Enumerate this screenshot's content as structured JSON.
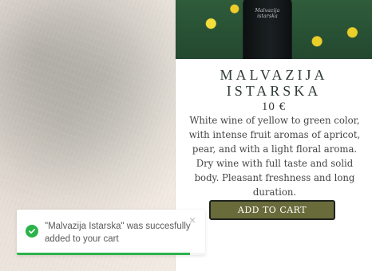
{
  "product": {
    "title": "MALVAZIJA ISTARSKA",
    "price": "10 €",
    "description": "White wine of yellow to green color, with intense fruit aromas of apricot, pear, and with a light floral aroma. Dry wine with full taste and solid body. Pleasant freshness and long duration.",
    "bottle_label": "Malvazija istarska",
    "add_to_cart_label": "ADD TO CART"
  },
  "toast": {
    "message": "\"Malvazija Istarska\" was succesfully added to your cart",
    "close_label": "×",
    "progress_fraction": 0.92
  },
  "theme": {
    "toast_success": "#2bb34a",
    "button_bg": "#6a6b3b"
  },
  "icons": {
    "toast_status": "check-circle-icon"
  }
}
